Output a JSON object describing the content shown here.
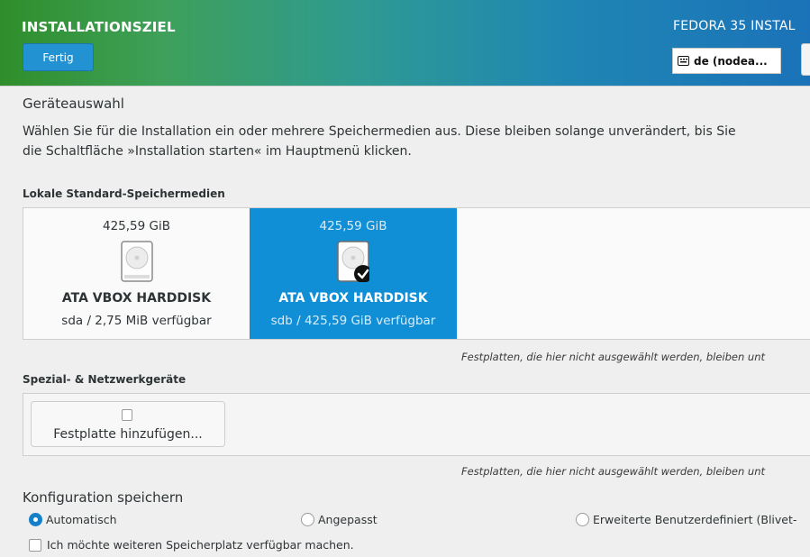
{
  "header": {
    "spoke_title": "INSTALLATIONSZIEL",
    "done_label": "Fertig",
    "product_title": "FEDORA 35 INSTAL",
    "keyboard_layout": "de (nodea..."
  },
  "device_selection": {
    "heading": "Geräteauswahl",
    "instruction_line1": "Wählen Sie für die Installation ein oder mehrere Speichermedien aus. Diese bleiben solange unverändert, bis Sie",
    "instruction_line2": "die Schaltfläche »Installation starten« im Hauptmenü klicken."
  },
  "local_disks": {
    "label": "Lokale Standard-Speichermedien",
    "disks": [
      {
        "size": "425,59 GiB",
        "name": "ATA VBOX HARDDISK",
        "free": "sda  /  2,75 MiB verfügbar",
        "selected": false
      },
      {
        "size": "425,59 GiB",
        "name": "ATA VBOX HARDDISK",
        "free": "sdb  /  425,59 GiB verfügbar",
        "selected": true
      }
    ],
    "note": "Festplatten, die hier nicht ausgewählt werden, bleiben unt"
  },
  "special_disks": {
    "label": "Spezial- & Netzwerkgeräte",
    "add_button": "Festplatte hinzufügen...",
    "note": "Festplatten, die hier nicht ausgewählt werden, bleiben unt"
  },
  "storage_config": {
    "heading": "Konfiguration speichern",
    "options": [
      {
        "label": "Automatisch",
        "selected": true
      },
      {
        "label": "Angepasst",
        "selected": false
      },
      {
        "label": "Erweiterte Benutzerdefiniert (Blivet-",
        "selected": false
      }
    ],
    "reclaim_checkbox": "Ich möchte weiteren Speicherplatz verfügbar machen.",
    "reclaim_checked": false
  },
  "colors": {
    "selected_disk": "#108fd6",
    "done_button": "#2392d2",
    "radio_selected": "#1580c9"
  }
}
